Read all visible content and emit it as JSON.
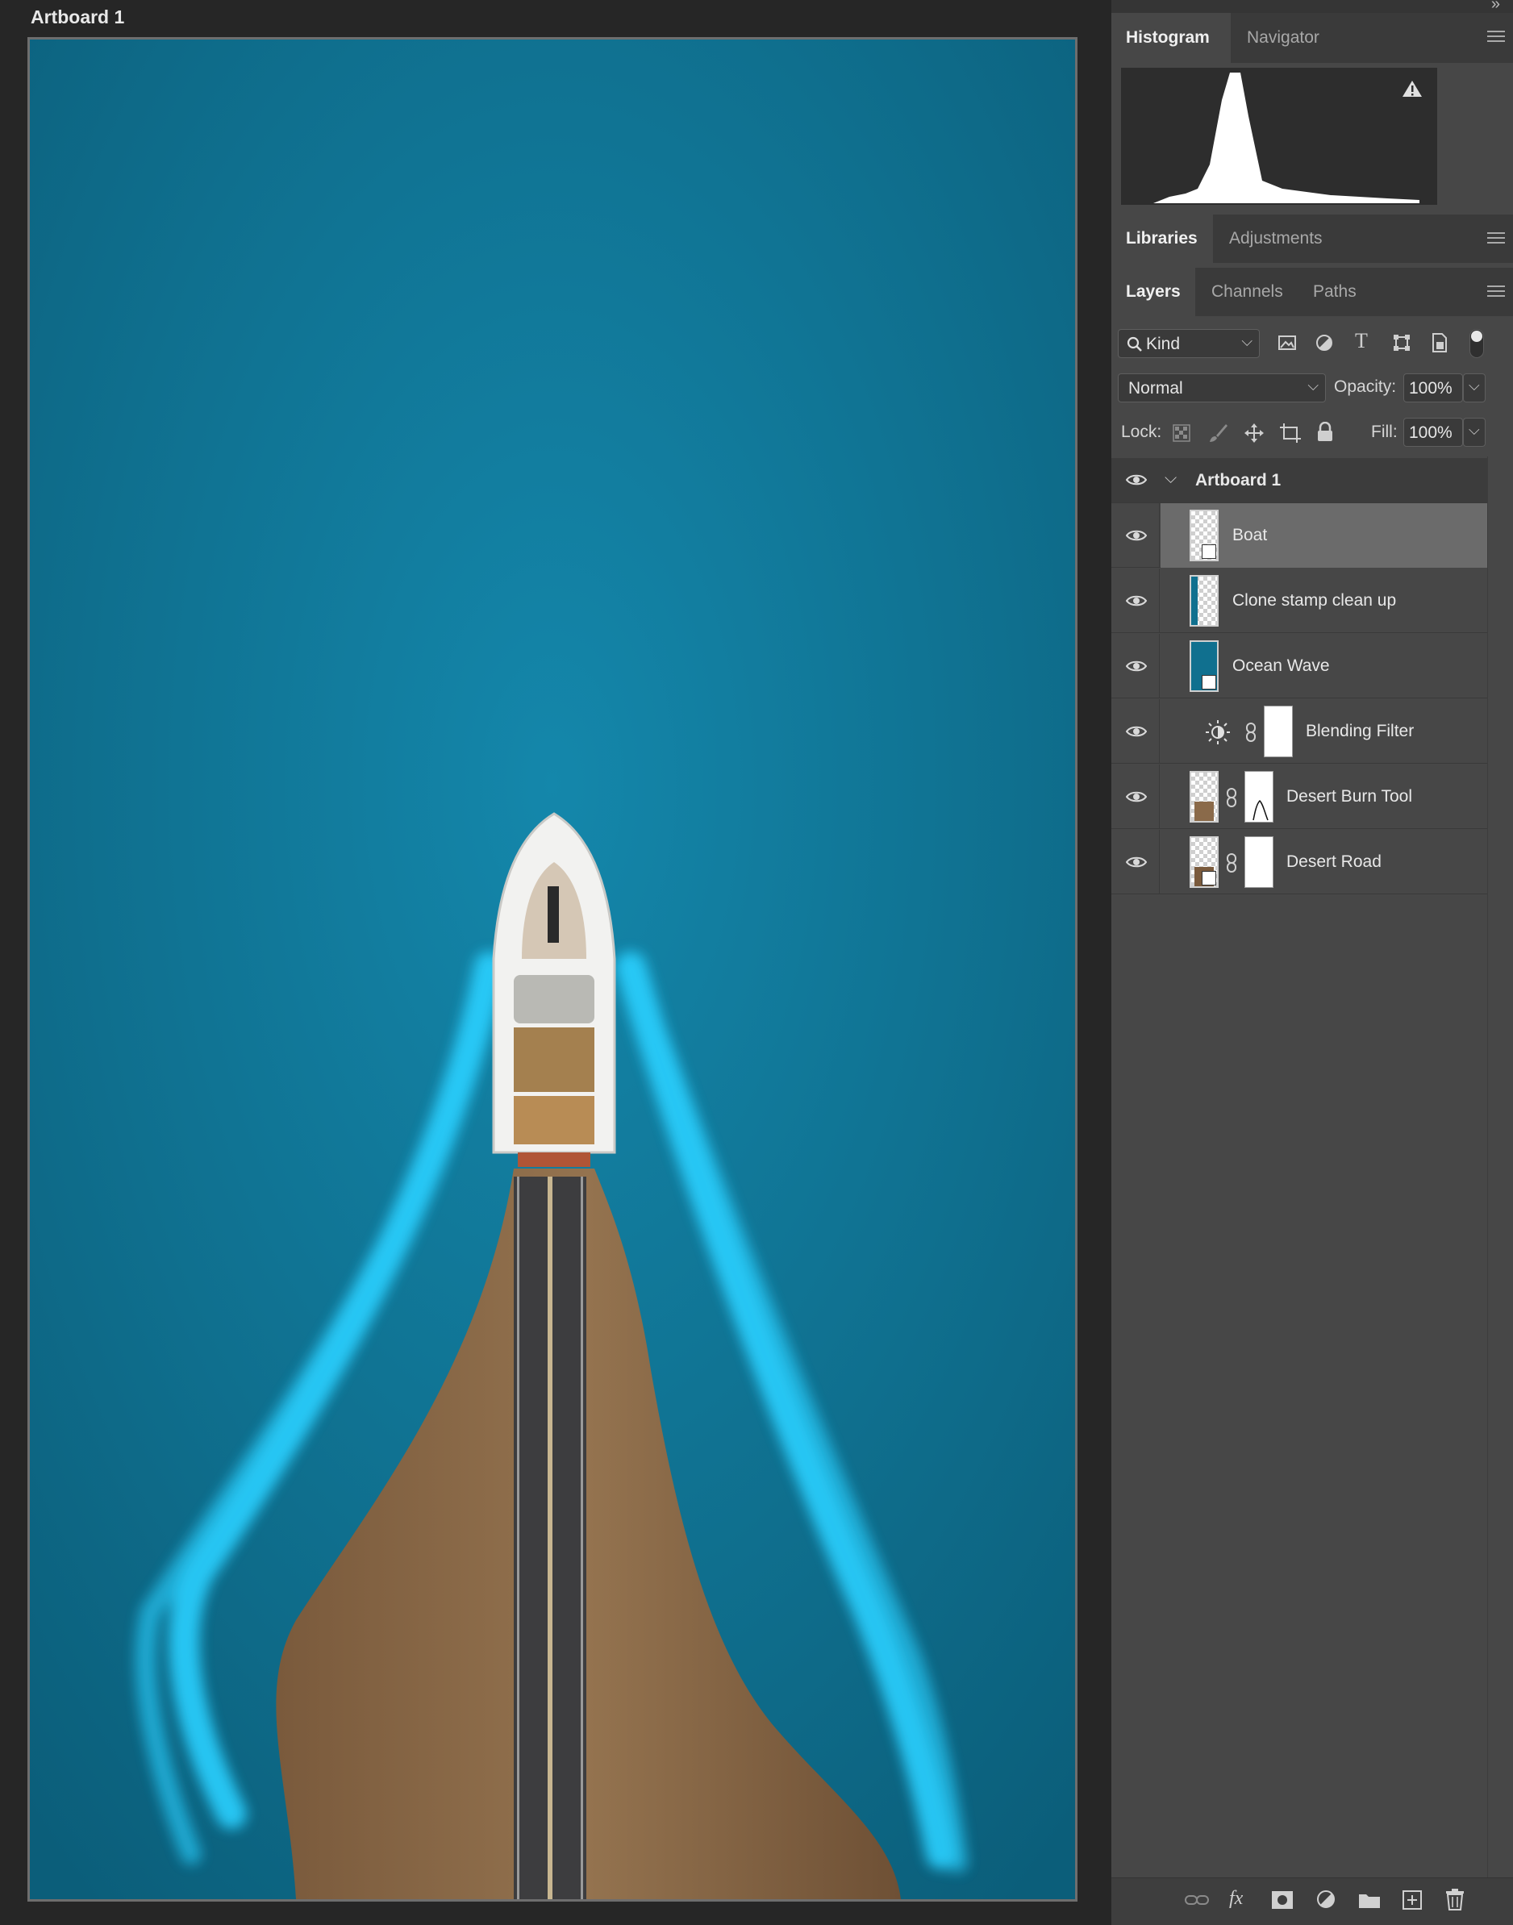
{
  "canvas": {
    "artboard_label": "Artboard 1"
  },
  "panels": {
    "top_tabs": [
      {
        "label": "Histogram",
        "active": true
      },
      {
        "label": "Navigator",
        "active": false
      }
    ],
    "mid_tabs": [
      {
        "label": "Libraries",
        "active": true
      },
      {
        "label": "Adjustments",
        "active": false
      }
    ],
    "layer_tabs": [
      {
        "label": "Layers",
        "active": true
      },
      {
        "label": "Channels",
        "active": false
      },
      {
        "label": "Paths",
        "active": false
      }
    ]
  },
  "layers_panel": {
    "filter_kind": "Kind",
    "blend_mode": "Normal",
    "opacity_label": "Opacity:",
    "opacity_value": "100%",
    "lock_label": "Lock:",
    "fill_label": "Fill:",
    "fill_value": "100%",
    "group": {
      "name": "Artboard 1"
    },
    "layers": [
      {
        "name": "Boat",
        "selected": true
      },
      {
        "name": "Clone stamp clean up",
        "selected": false
      },
      {
        "name": "Ocean Wave",
        "selected": false
      },
      {
        "name": "Blending Filter",
        "selected": false
      },
      {
        "name": "Desert Burn Tool",
        "selected": false
      },
      {
        "name": "Desert Road",
        "selected": false
      }
    ]
  },
  "icons": {
    "filter_icons": [
      "image-filter-icon",
      "adjustment-filter-icon",
      "type-filter-icon",
      "shape-filter-icon",
      "smart-object-filter-icon"
    ],
    "lock_icons": [
      "lock-transparent-icon",
      "lock-paint-icon",
      "lock-position-icon",
      "lock-artboard-icon",
      "lock-all-icon"
    ],
    "bottom_icons": [
      "link-layers-icon",
      "fx-icon",
      "add-mask-icon",
      "new-adjustment-icon",
      "new-group-icon",
      "new-layer-icon",
      "delete-layer-icon"
    ]
  },
  "colors": {
    "water": "#10708f",
    "wake": "#2ad0ff",
    "sand": "#8a6a4a",
    "panel_bg": "#474747",
    "selected_row": "#6b6b6b"
  }
}
